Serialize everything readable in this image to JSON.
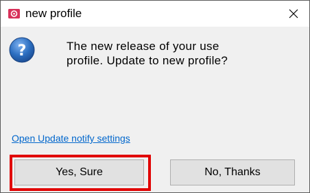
{
  "window": {
    "title": "new profile",
    "app_icon": "app-logo-icon",
    "close_icon": "close-icon"
  },
  "dialog": {
    "icon": "question-icon",
    "message_line1": "The new release of your use",
    "message_line2": "profile. Update to new profile?",
    "link_text": "Open Update notify settings",
    "yes_label": "Yes, Sure",
    "no_label": "No, Thanks"
  },
  "colors": {
    "link": "#0066cc",
    "highlight": "#e10000",
    "app_icon": "#d8315a",
    "question_icon": "#2d6fc1"
  }
}
